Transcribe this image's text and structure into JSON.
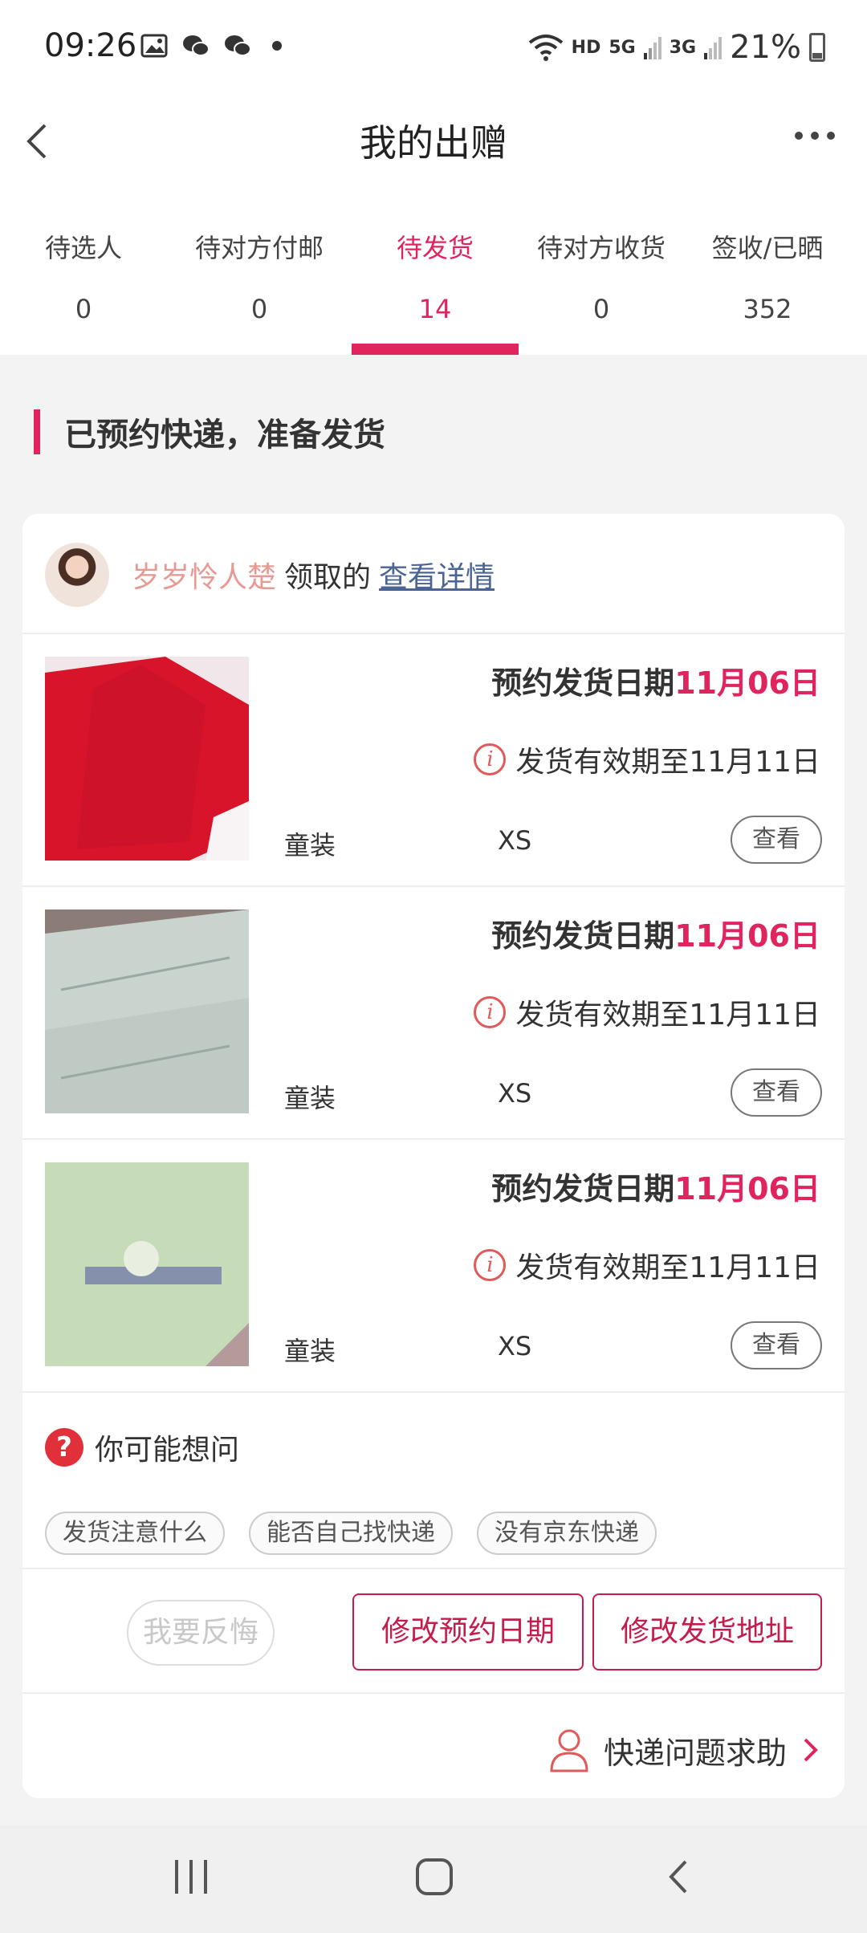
{
  "status_bar": {
    "time": "09:26",
    "network_hd": "HD",
    "network_5g": "5G",
    "network_3g": "3G",
    "battery": "21%"
  },
  "header": {
    "title": "我的出赠"
  },
  "tabs": [
    {
      "label": "待选人",
      "count": "0"
    },
    {
      "label": "待对方付邮",
      "count": "0"
    },
    {
      "label": "待发货",
      "count": "14"
    },
    {
      "label": "待对方收货",
      "count": "0"
    },
    {
      "label": "签收/已晒",
      "count": "352"
    }
  ],
  "section": {
    "title": "已预约快递，准备发货"
  },
  "receiver": {
    "name": "岁岁怜人楚",
    "action": "领取的",
    "link": "查看详情"
  },
  "items": [
    {
      "date_label": "预约发货日期",
      "date_value": "11月06日",
      "valid_text": "发货有效期至11月11日",
      "category": "童装",
      "size": "XS",
      "view_label": "查看"
    },
    {
      "date_label": "预约发货日期",
      "date_value": "11月06日",
      "valid_text": "发货有效期至11月11日",
      "category": "童装",
      "size": "XS",
      "view_label": "查看"
    },
    {
      "date_label": "预约发货日期",
      "date_value": "11月06日",
      "valid_text": "发货有效期至11月11日",
      "category": "童装",
      "size": "XS",
      "view_label": "查看"
    }
  ],
  "faq": {
    "title": "你可能想问",
    "chips": [
      "发货注意什么",
      "能否自己找快递",
      "没有京东快递"
    ]
  },
  "actions": {
    "regret": "我要反悔",
    "change_date": "修改预约日期",
    "change_address": "修改发货地址"
  },
  "help": {
    "label": "快递问题求助"
  },
  "colors": {
    "accent": "#e0245e",
    "button_border": "#c41d4b",
    "name": "#e79a93",
    "link": "#4a6496"
  }
}
